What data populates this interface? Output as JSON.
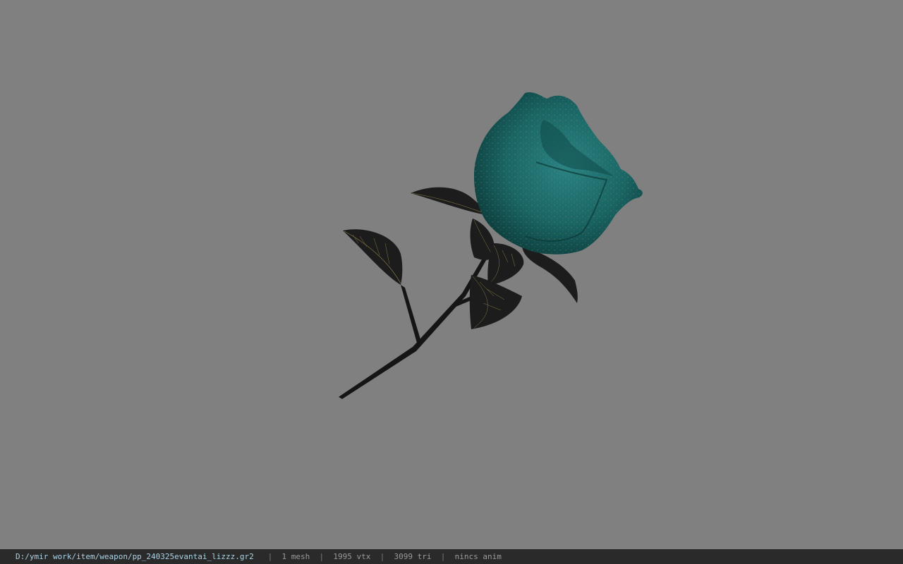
{
  "viewport": {
    "background": "#808080",
    "model": {
      "petal_color": "#1e6b6b",
      "petal_dark": "#0f4848",
      "leaf_color": "#1c1c1c",
      "vein_color": "#8a7a45"
    }
  },
  "status": {
    "path": "D:/ymir work/item/weapon/pp_240325evantai_lizzz.gr2",
    "separator": "|",
    "meshes": "1 mesh",
    "vertices": "1995 vtx",
    "triangles": "3099 tri",
    "animation": "nincs anim"
  }
}
